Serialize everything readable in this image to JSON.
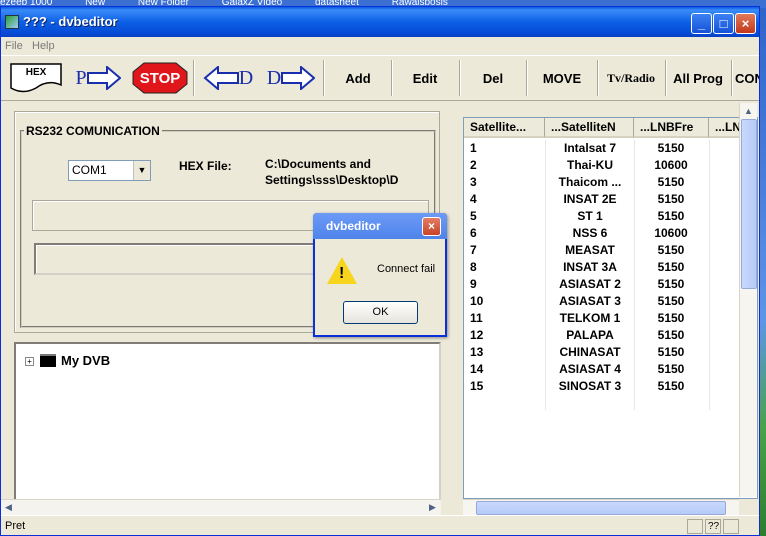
{
  "desktop": {
    "strip_items": [
      "ezeeb 1000",
      "New",
      "New Folder",
      "GalaxZ Video",
      "datasheet",
      "Rawalsbosis"
    ]
  },
  "window": {
    "title": "??? - dvbeditor",
    "title_buttons": {
      "minimize": "_",
      "maximize": "□",
      "close": "×"
    }
  },
  "menu": {
    "file": "File",
    "help": "Help"
  },
  "toolbar": {
    "hex_label": "HEX",
    "p_label": "P",
    "stop_label": "STOP",
    "d_left_label": "D",
    "d_right_label": "D",
    "add_label": "Add",
    "edit_label": "Edit",
    "del_label": "Del",
    "move_label": "MOVE",
    "tvradio_label": "Tv/Radio",
    "allprog_label": "All Prog",
    "con_label": "CON",
    "colors": {
      "stop": "#e0161b",
      "arrow": "#1a2fae"
    }
  },
  "rs232": {
    "legend": "RS232 COMUNICATION",
    "com_port": "COM1",
    "hex_file_label": "HEX File:",
    "hex_path_line1": "C:\\Documents and",
    "hex_path_line2": "Settings\\sss\\Desktop\\D"
  },
  "tree": {
    "root_label": "My DVB",
    "expander": "+"
  },
  "table": {
    "headers": [
      "Satellite...",
      "...SatelliteN",
      "...LNBFre",
      "...LN"
    ],
    "rows": [
      {
        "no": "1",
        "name": "Intalsat 7",
        "fre": "5150"
      },
      {
        "no": "2",
        "name": "Thai-KU",
        "fre": "10600"
      },
      {
        "no": "3",
        "name": "Thaicom ...",
        "fre": "5150"
      },
      {
        "no": "4",
        "name": "INSAT 2E",
        "fre": "5150"
      },
      {
        "no": "5",
        "name": "ST 1",
        "fre": "5150"
      },
      {
        "no": "6",
        "name": "NSS 6",
        "fre": "10600"
      },
      {
        "no": "7",
        "name": "MEASAT",
        "fre": "5150"
      },
      {
        "no": "8",
        "name": "INSAT 3A",
        "fre": "5150"
      },
      {
        "no": "9",
        "name": "ASIASAT 2",
        "fre": "5150"
      },
      {
        "no": "10",
        "name": "ASIASAT 3",
        "fre": "5150"
      },
      {
        "no": "11",
        "name": "TELKOM 1",
        "fre": "5150"
      },
      {
        "no": "12",
        "name": "PALAPA",
        "fre": "5150"
      },
      {
        "no": "13",
        "name": "CHINASAT",
        "fre": "5150"
      },
      {
        "no": "14",
        "name": "ASIASAT 4",
        "fre": "5150"
      },
      {
        "no": "15",
        "name": "SINOSAT 3",
        "fre": "5150"
      }
    ]
  },
  "status": {
    "text": "Pret",
    "cell2": "??"
  },
  "dialog": {
    "title": "dvbeditor",
    "message": "Connect fail",
    "ok_label": "OK",
    "icon": "warning-icon",
    "close": "×"
  }
}
